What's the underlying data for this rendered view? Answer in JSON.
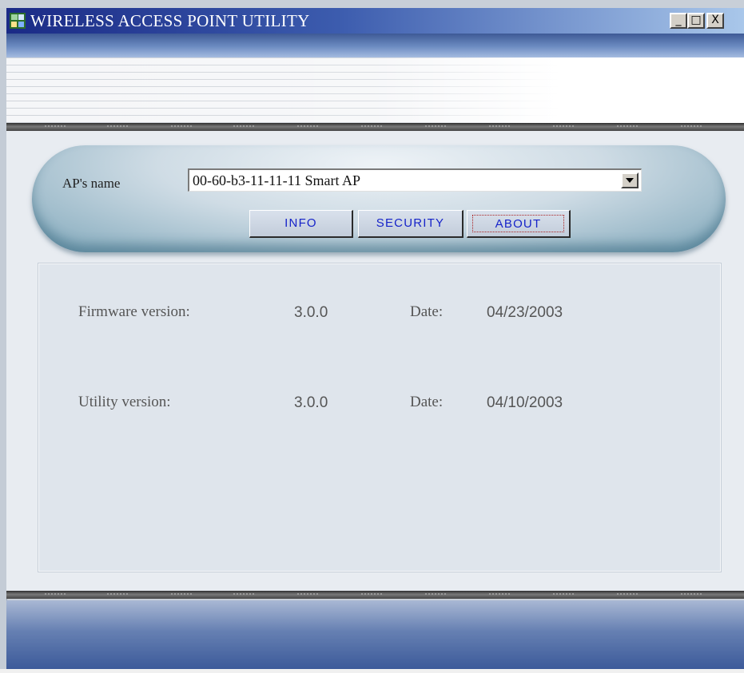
{
  "window": {
    "title": "WIRELESS ACCESS POINT UTILITY",
    "controls": {
      "minimize": "_",
      "maximize": "□",
      "close": "X"
    }
  },
  "ap_selector": {
    "label": "AP's name",
    "selected": "00-60-b3-11-11-11 Smart AP"
  },
  "tabs": [
    {
      "label": "INFO",
      "active": false
    },
    {
      "label": "SECURITY",
      "active": false
    },
    {
      "label": "ABOUT",
      "active": true
    }
  ],
  "about": {
    "firmware": {
      "label": "Firmware version:",
      "version": "3.0.0",
      "date_label": "Date:",
      "date": "04/23/2003"
    },
    "utility": {
      "label": "Utility version:",
      "version": "3.0.0",
      "date_label": "Date:",
      "date": "04/10/2003"
    }
  },
  "colors": {
    "title_gradient_start": "#1a2a86",
    "tab_text": "#1623c9",
    "pill_teal": "#7fa7ba",
    "panel_bg": "#dfe5ec"
  },
  "icons": [
    "app-icon",
    "minimize-icon",
    "maximize-icon",
    "close-icon",
    "dropdown-arrow-icon"
  ]
}
